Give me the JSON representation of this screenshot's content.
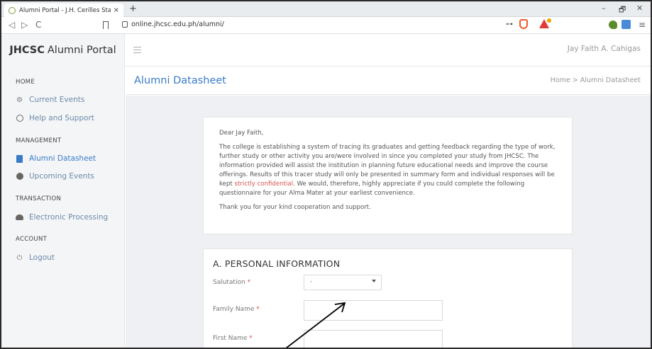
{
  "browser": {
    "tab_title": "Alumni Portal - J.H. Cerilles State C",
    "tab_close": "×",
    "new_tab": "+",
    "nav_back": "◁",
    "nav_forward": "▷",
    "nav_reload": "C",
    "url": "online.jhcsc.edu.ph/alumni/",
    "win_minimize": "–",
    "win_restore": "🗗",
    "win_close": "✕",
    "menu": "≡"
  },
  "header": {
    "brand_bold": "JHCSC",
    "brand_rest": "Alumni Portal",
    "user_name": "Jay Faith A. Cahigas"
  },
  "sidebar": {
    "section_home": "HOME",
    "section_management": "MANAGEMENT",
    "section_transaction": "TRANSACTION",
    "section_account": "ACCOUNT",
    "items": {
      "current_events": "Current Events",
      "help_support": "Help and Support",
      "alumni_datasheet": "Alumni Datasheet",
      "upcoming_events": "Upcoming Events",
      "electronic_processing": "Electronic Processing",
      "logout": "Logout"
    }
  },
  "page": {
    "title": "Alumni Datasheet",
    "breadcrumb": "Home  >  Alumni Datasheet"
  },
  "letter": {
    "greeting": "Dear Jay Faith,",
    "body_before": "The college is establishing a system of tracing its graduates and getting feedback regarding the type of work, further study or other activity you are/were involved in since you completed your study from JHCSC. The information provided will assist the institution in planning future educational needs and improve the course offerings. Results of this tracer study will only be presented in summary form and individual responses will be kept ",
    "highlight": "strictly confidential",
    "body_after": ". We would, therefore, highly appreciate if you could complete the following questionnaire for your Alma Mater at your earliest convenience.",
    "closing": "Thank you for your kind cooperation and support."
  },
  "form": {
    "section_title": "A. PERSONAL INFORMATION",
    "salutation_label": "Salutation",
    "salutation_value": "-",
    "family_name_label": "Family Name",
    "first_name_label": "First Name",
    "required_mark": "*"
  }
}
